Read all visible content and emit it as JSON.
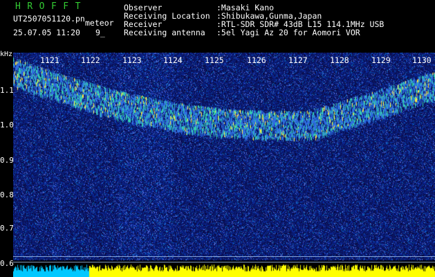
{
  "header": {
    "logo": "HROFFT",
    "file_name": "UT2507051120.pn",
    "event_type": "meteor",
    "timestamp": "25.07.05 11:20",
    "count": "9_"
  },
  "station_info": [
    {
      "label": "Observer",
      "value": ":Masaki Kano"
    },
    {
      "label": "Receiving Location",
      "value": ":Shibukawa,Gunma,Japan"
    },
    {
      "label": "Receiver",
      "value": ":RTL-SDR SDR# 43dB L15 114.1MHz USB"
    },
    {
      "label": "Receiving antenna",
      "value": ":5el Yagi Az 20 for Aomori VOR"
    }
  ],
  "spectrogram": {
    "y_unit": "kHz",
    "y_ticks": [
      "1.1",
      "1.0",
      "0.9",
      "0.8",
      "0.7",
      "0.6"
    ],
    "x_ticks": [
      "1121",
      "1122",
      "1123",
      "1124",
      "1125",
      "1126",
      "1127",
      "1128",
      "1129",
      "1130"
    ],
    "colors": {
      "background": "#000000",
      "noise": "#1a3acc",
      "signal": "#35d0b0",
      "hot": "#ffff30",
      "power": "#ffff00",
      "power_low": "#00c8ff"
    }
  }
}
